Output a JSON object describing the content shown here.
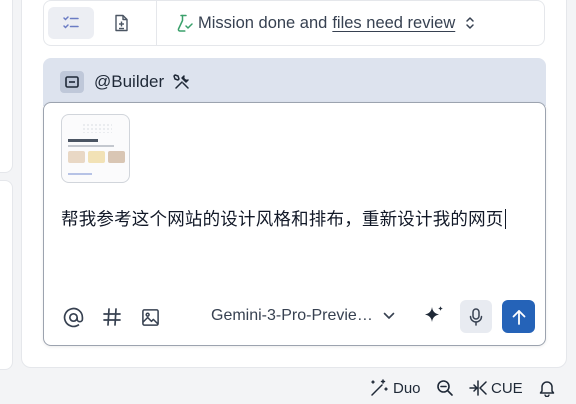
{
  "top_bar": {
    "mission_prefix": "Mission done and",
    "mission_link": "files need review"
  },
  "composer": {
    "agent_name": "@Builder",
    "prompt_text": "帮我参考这个网站的设计风格和排布，重新设计我的网页",
    "model_name": "Gemini-3-Pro-Previe…"
  },
  "status_bar": {
    "duo_label": "Duo",
    "cue_label": "CUE"
  },
  "colors": {
    "accent": "#2563b8",
    "composer_header": "#dde3ee",
    "mission_icon": "#3aa06b"
  },
  "icons": {
    "checklist": "checklist-icon",
    "document": "document-icon",
    "mission": "flask-check-icon",
    "at": "at-sign-icon",
    "hash": "hash-icon",
    "image": "image-icon",
    "sparkle": "sparkle-icon",
    "mic": "microphone-icon",
    "send": "arrow-up-icon",
    "duo": "duo-wand-icon",
    "zoom": "zoom-out-icon",
    "cue": "cue-icon",
    "bell": "bell-icon"
  }
}
